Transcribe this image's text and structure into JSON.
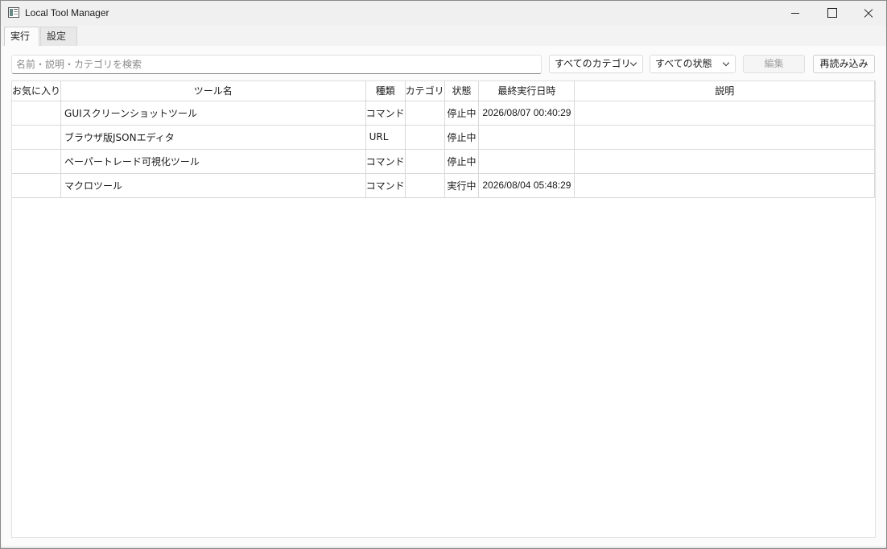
{
  "window": {
    "title": "Local Tool Manager"
  },
  "tabs": [
    {
      "label": "実行",
      "active": true
    },
    {
      "label": "設定",
      "active": false
    }
  ],
  "toolbar": {
    "search_placeholder": "名前・説明・カテゴリを検索",
    "search_value": "",
    "category_filter": "すべてのカテゴリ",
    "state_filter": "すべての状態",
    "edit_label": "編集",
    "reload_label": "再読み込み"
  },
  "table": {
    "columns": [
      "お気に入り",
      "ツール名",
      "種類",
      "カテゴリ",
      "状態",
      "最終実行日時",
      "説明"
    ],
    "rows": [
      {
        "favorite": "",
        "name": "GUIスクリーンショットツール",
        "type": "コマンド",
        "category": "",
        "state": "停止中",
        "last_run": "2026/08/07 00:40:29",
        "description": ""
      },
      {
        "favorite": "",
        "name": "ブラウザ版JSONエディタ",
        "type": "URL",
        "category": "",
        "state": "停止中",
        "last_run": "",
        "description": ""
      },
      {
        "favorite": "",
        "name": "ペーパートレード可視化ツール",
        "type": "コマンド",
        "category": "",
        "state": "停止中",
        "last_run": "",
        "description": ""
      },
      {
        "favorite": "",
        "name": "マクロツール",
        "type": "コマンド",
        "category": "",
        "state": "実行中",
        "last_run": "2026/08/04 05:48:29",
        "description": ""
      }
    ]
  }
}
